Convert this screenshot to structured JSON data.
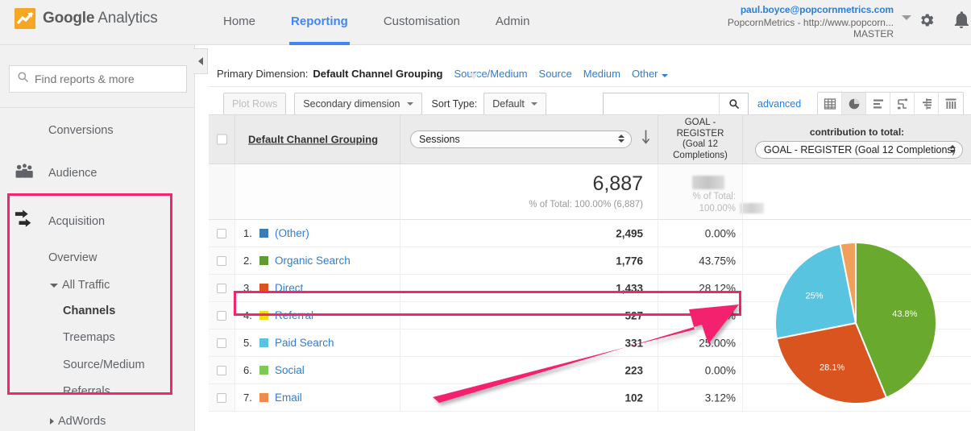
{
  "topbar": {
    "brand_bold": "Google",
    "brand_light": " Analytics",
    "logo_icon": "google-analytics-logo",
    "nav": [
      {
        "label": "Home",
        "active": false
      },
      {
        "label": "Reporting",
        "active": true
      },
      {
        "label": "Customisation",
        "active": false
      },
      {
        "label": "Admin",
        "active": false
      }
    ],
    "account": {
      "email": "paul.boyce@popcornmetrics.com",
      "property": "PopcornMetrics - http://www.popcorn...",
      "view": "MASTER",
      "caret_icon": "chevron-down-icon"
    },
    "gear_icon": "gear-icon",
    "bell_icon": "bell-icon",
    "accent_blue": "#4285f4",
    "logo_orange": "#f5a623"
  },
  "sidebar": {
    "search_placeholder": "Find reports & more",
    "search_icon": "search-icon",
    "collapse_icon": "collapse-left-icon",
    "items": [
      {
        "label": "Conversions",
        "icon": null,
        "level": "section",
        "bold": false
      },
      {
        "label": "Audience",
        "icon": "audience-people-icon",
        "level": "section",
        "bold": false
      },
      {
        "label": "Acquisition",
        "icon": "acquisition-arrows-icon",
        "level": "section",
        "bold": false
      },
      {
        "label": "Overview",
        "icon": null,
        "level": "sub",
        "bold": false
      },
      {
        "label": "All Traffic",
        "icon": "triangle-down-icon",
        "level": "sub",
        "bold": false
      },
      {
        "label": "Channels",
        "icon": null,
        "level": "subsub",
        "bold": true
      },
      {
        "label": "Treemaps",
        "icon": null,
        "level": "subsub",
        "bold": false
      },
      {
        "label": "Source/Medium",
        "icon": null,
        "level": "subsub",
        "bold": false
      },
      {
        "label": "Referrals",
        "icon": null,
        "level": "subsub",
        "bold": false
      },
      {
        "label": "AdWords",
        "icon": "triangle-right-icon",
        "level": "sub",
        "bold": false
      }
    ]
  },
  "primary_dimension": {
    "label": "Primary Dimension:",
    "current": "Default Channel Grouping",
    "links": [
      "Source/Medium",
      "Source",
      "Medium"
    ],
    "other_label": "Other",
    "other_caret_icon": "chevron-down-icon"
  },
  "toolbar": {
    "plot_rows_label": "Plot Rows",
    "secondary_dimension_label": "Secondary dimension",
    "sort_type_label": "Sort Type:",
    "sort_type_value": "Default",
    "search_value": "",
    "search_icon": "magnifier-icon",
    "advanced_label": "advanced",
    "view_icons": [
      {
        "name": "table-view-icon",
        "active": false
      },
      {
        "name": "pie-chart-view-icon",
        "active": true
      },
      {
        "name": "bar-chart-view-icon",
        "active": false
      },
      {
        "name": "performance-view-icon",
        "active": false
      },
      {
        "name": "comparison-view-icon",
        "active": false
      },
      {
        "name": "pivot-view-icon",
        "active": false
      }
    ]
  },
  "table": {
    "dimension_header": "Default Channel Grouping",
    "metric_select_value": "Sessions",
    "sort_arrow_icon": "sort-descending-arrow-icon",
    "goal_header_lines": [
      "GOAL -",
      "REGISTER",
      "(Goal 12",
      "Completions)"
    ],
    "contribution_title": "contribution to total:",
    "contribution_select_value": "GOAL - REGISTER (Goal 12 Completions)",
    "totals": {
      "sessions": "6,887",
      "sessions_sub": "% of Total: 100.00% (6,887)",
      "goal_value": "",
      "goal_sub_line1": "% of Total:",
      "goal_sub_line2": "100.00%"
    },
    "rows": [
      {
        "index": "1.",
        "name": "(Other)",
        "color": "#3c7cb5",
        "sessions": "2,495",
        "goal_pct": "0.00%",
        "highlighted": false
      },
      {
        "index": "2.",
        "name": "Organic Search",
        "color": "#5d9c33",
        "sessions": "1,776",
        "goal_pct": "43.75%",
        "highlighted": false
      },
      {
        "index": "3.",
        "name": "Direct",
        "color": "#d9541f",
        "sessions": "1,433",
        "goal_pct": "28.12%",
        "highlighted": true
      },
      {
        "index": "4.",
        "name": "Referral",
        "color": "#eede1a",
        "sessions": "527",
        "goal_pct": "0.00%",
        "highlighted": false
      },
      {
        "index": "5.",
        "name": "Paid Search",
        "color": "#58c4e0",
        "sessions": "331",
        "goal_pct": "25.00%",
        "highlighted": false
      },
      {
        "index": "6.",
        "name": "Social",
        "color": "#7dc955",
        "sessions": "223",
        "goal_pct": "0.00%",
        "highlighted": false
      },
      {
        "index": "7.",
        "name": "Email",
        "color": "#ef8a4f",
        "sessions": "102",
        "goal_pct": "3.12%",
        "highlighted": false
      }
    ]
  },
  "chart_data": {
    "type": "pie",
    "title": "",
    "categories": [
      "Organic Search",
      "Direct",
      "Paid Search",
      "Email"
    ],
    "values": [
      43.8,
      28.1,
      25,
      3.1
    ],
    "labels": [
      "43.8%",
      "28.1%",
      "25%",
      ""
    ],
    "colors": [
      "#68a92e",
      "#d9541f",
      "#58c4e0",
      "#f0a05a"
    ],
    "legend": "none",
    "unit": "percent",
    "source_metric": "GOAL - REGISTER (Goal 12 Completions)"
  },
  "annotations": {
    "highlight_color": "#f4246e",
    "boxes": [
      "sidebar-acquisition-section",
      "table-row-direct"
    ],
    "arrow": {
      "name": "annotation-arrow",
      "points_to": "28.12%"
    }
  }
}
